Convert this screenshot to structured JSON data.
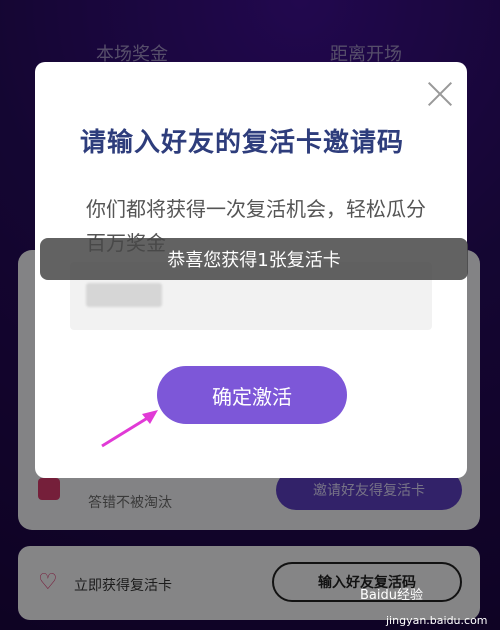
{
  "background": {
    "label_prize": "本场奖金",
    "label_countdown": "距离开场",
    "card_sub_text": "答错不被淘汰",
    "card_button": "邀请好友得复活卡",
    "bottom_text": "立即获得复活卡",
    "bottom_button": "输入好友复活码"
  },
  "modal": {
    "title": "请输入好友的复活卡邀请码",
    "description": "你们都将获得一次复活机会，轻松瓜分百万奖金",
    "confirm_label": "确定激活"
  },
  "toast": {
    "message": "恭喜您获得1张复活卡"
  },
  "watermark": {
    "brand": "Baidu经验",
    "url": "jingyan.baidu.com"
  },
  "colors": {
    "accent": "#7d57d8",
    "title": "#2e3d7c",
    "arrow": "#e13ad6"
  },
  "icons": {
    "close": "close-icon",
    "heart": "heart-plus-icon",
    "arrow": "pointer-arrow-icon"
  }
}
